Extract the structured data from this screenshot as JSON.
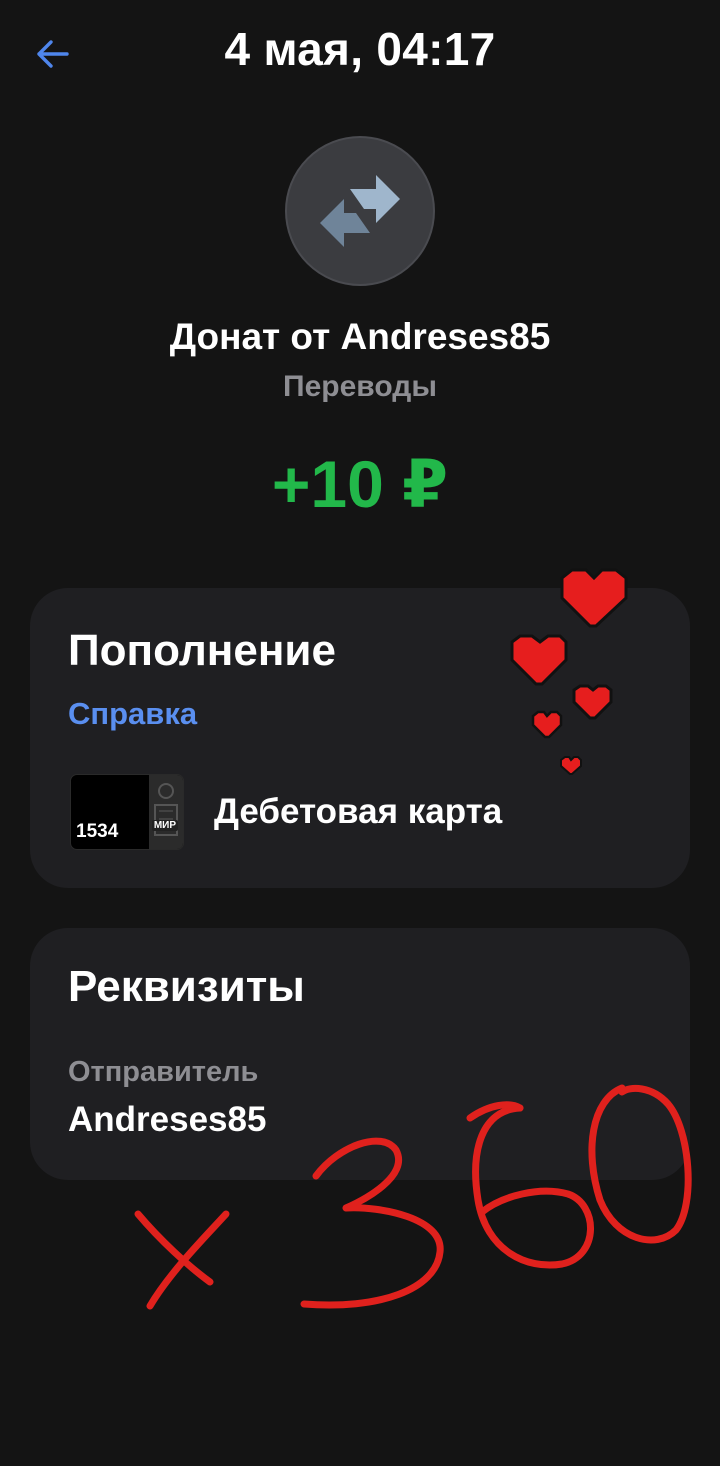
{
  "header": {
    "back_icon": "arrow-left-icon",
    "title": "4 мая, 04:17"
  },
  "transaction": {
    "icon": "transfer-arrows-icon",
    "name": "Донат от Andreses85",
    "category": "Переводы",
    "amount": "+10 ₽",
    "amount_color": "#22b84a"
  },
  "topup_card": {
    "title": "Пополнение",
    "help_link": "Справка",
    "payment_card": {
      "last_digits": "1534",
      "system": "МИР",
      "name": "Дебетовая карта"
    }
  },
  "details_card": {
    "title": "Реквизиты",
    "sender_label": "Отправитель",
    "sender_value": "Andreses85"
  },
  "overlay": {
    "handwriting": "x 360",
    "hearts_color": "#e61e1e"
  },
  "colors": {
    "background": "#141414",
    "card": "#1f1f22",
    "accent": "#5a8ff0",
    "muted": "#8e8e93"
  }
}
